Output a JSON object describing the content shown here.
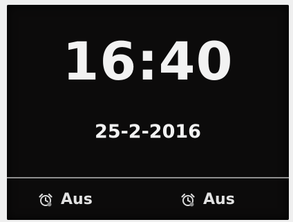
{
  "clock": {
    "time": "16:40",
    "date": "25-2-2016"
  },
  "alarms": [
    {
      "icon": "alarm-clock-icon",
      "label": "Aus"
    },
    {
      "icon": "alarm-clock-icon",
      "label": "Aus"
    }
  ],
  "colors": {
    "screen_background": "#0c0b0b",
    "text": "#f2f2f2",
    "divider": "#8f8f8f"
  }
}
